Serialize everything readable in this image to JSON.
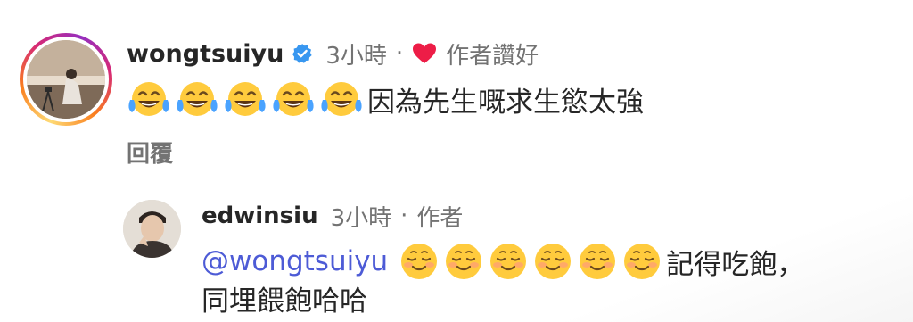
{
  "comment": {
    "username": "wongtsuiyu",
    "time": "3小時",
    "separator": "·",
    "liked_by_author": "作者讚好",
    "emoji_count": 5,
    "text": "因為先生嘅求生慾太強",
    "reply_label": "回覆",
    "verified_color": "#3897f0",
    "heart_color": "#ed1d47"
  },
  "reply": {
    "username": "edwinsiu",
    "time": "3小時",
    "separator": "·",
    "author_tag": "作者",
    "mention": "@wongtsuiyu",
    "emoji_count": 6,
    "text_line1": "記得吃飽，",
    "text_line2": "同埋餵飽哈哈",
    "mention_color": "#4d5bd6"
  }
}
